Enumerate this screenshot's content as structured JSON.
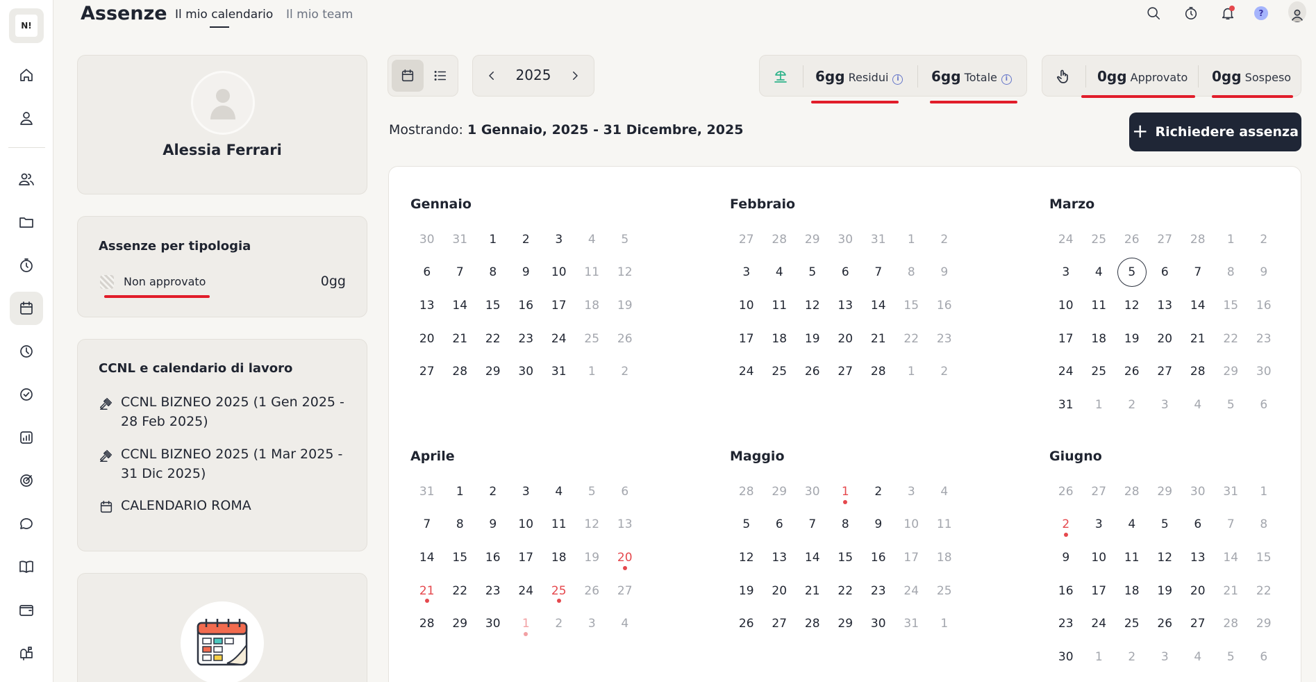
{
  "sidebar": {
    "logo_text": "N!",
    "items": [
      {
        "name": "home-icon"
      },
      {
        "name": "user-icon"
      },
      {
        "name": "users-icon"
      },
      {
        "name": "folder-icon"
      },
      {
        "name": "stopwatch-icon"
      },
      {
        "name": "calendar-icon",
        "active": true
      },
      {
        "name": "clock-pie-icon"
      },
      {
        "name": "check-circle-icon"
      },
      {
        "name": "chart-icon"
      },
      {
        "name": "target-icon"
      },
      {
        "name": "chat-icon"
      },
      {
        "name": "book-icon"
      },
      {
        "name": "wallet-icon"
      },
      {
        "name": "mailbox-icon"
      }
    ]
  },
  "header": {
    "title": "Assenze",
    "tabs": [
      {
        "label": "Il mio calendario",
        "active": true
      },
      {
        "label": "Il mio team",
        "active": false
      }
    ],
    "help_label": "?"
  },
  "profile": {
    "name": "Alessia Ferrari"
  },
  "absence_types": {
    "title": "Assenze per tipologia",
    "items": [
      {
        "label": "Non approvato",
        "value": "0gg"
      }
    ]
  },
  "ccnl": {
    "title": "CCNL e calendario di lavoro",
    "items": [
      {
        "icon": "gavel-icon",
        "label": "CCNL BIZNEO 2025 (1 Gen 2025 - 28 Feb 2025)"
      },
      {
        "icon": "gavel-icon",
        "label": "CCNL BIZNEO 2025 (1 Mar 2025 - 31 Dic 2025)"
      },
      {
        "icon": "calendar-icon",
        "label": "CALENDARIO ROMA"
      }
    ]
  },
  "year_nav": {
    "year": "2025"
  },
  "stats": {
    "residui": {
      "value": "6gg",
      "label": "Residui"
    },
    "totale": {
      "value": "6gg",
      "label": "Totale"
    },
    "approvato": {
      "value": "0gg",
      "label": "Approvato"
    },
    "sospeso": {
      "value": "0gg",
      "label": "Sospeso"
    }
  },
  "showing": {
    "prefix": "Mostrando: ",
    "range": "1 Gennaio, 2025 - 31 Dicembre, 2025"
  },
  "request_button": {
    "label": "Richiedere assenza"
  },
  "colors": {
    "primary_button": "#1f2636",
    "holiday": "#e5484d",
    "panel_bg": "#efede9"
  },
  "calendar": {
    "months": [
      {
        "name": "Gennaio",
        "days": [
          {
            "d": "30",
            "out": true
          },
          {
            "d": "31",
            "out": true
          },
          {
            "d": "1"
          },
          {
            "d": "2"
          },
          {
            "d": "3"
          },
          {
            "d": "4",
            "out": true
          },
          {
            "d": "5",
            "out": true
          },
          {
            "d": "6"
          },
          {
            "d": "7"
          },
          {
            "d": "8"
          },
          {
            "d": "9"
          },
          {
            "d": "10"
          },
          {
            "d": "11",
            "out": true
          },
          {
            "d": "12",
            "out": true
          },
          {
            "d": "13"
          },
          {
            "d": "14"
          },
          {
            "d": "15"
          },
          {
            "d": "16"
          },
          {
            "d": "17"
          },
          {
            "d": "18",
            "out": true
          },
          {
            "d": "19",
            "out": true
          },
          {
            "d": "20"
          },
          {
            "d": "21"
          },
          {
            "d": "22"
          },
          {
            "d": "23"
          },
          {
            "d": "24"
          },
          {
            "d": "25",
            "out": true
          },
          {
            "d": "26",
            "out": true
          },
          {
            "d": "27"
          },
          {
            "d": "28"
          },
          {
            "d": "29"
          },
          {
            "d": "30"
          },
          {
            "d": "31"
          },
          {
            "d": "1",
            "out": true
          },
          {
            "d": "2",
            "out": true
          }
        ]
      },
      {
        "name": "Febbraio",
        "days": [
          {
            "d": "27",
            "out": true
          },
          {
            "d": "28",
            "out": true
          },
          {
            "d": "29",
            "out": true
          },
          {
            "d": "30",
            "out": true
          },
          {
            "d": "31",
            "out": true
          },
          {
            "d": "1",
            "out": true
          },
          {
            "d": "2",
            "out": true
          },
          {
            "d": "3"
          },
          {
            "d": "4"
          },
          {
            "d": "5"
          },
          {
            "d": "6"
          },
          {
            "d": "7"
          },
          {
            "d": "8",
            "out": true
          },
          {
            "d": "9",
            "out": true
          },
          {
            "d": "10"
          },
          {
            "d": "11"
          },
          {
            "d": "12"
          },
          {
            "d": "13"
          },
          {
            "d": "14"
          },
          {
            "d": "15",
            "out": true
          },
          {
            "d": "16",
            "out": true
          },
          {
            "d": "17"
          },
          {
            "d": "18"
          },
          {
            "d": "19"
          },
          {
            "d": "20"
          },
          {
            "d": "21"
          },
          {
            "d": "22",
            "out": true
          },
          {
            "d": "23",
            "out": true
          },
          {
            "d": "24"
          },
          {
            "d": "25"
          },
          {
            "d": "26"
          },
          {
            "d": "27"
          },
          {
            "d": "28"
          },
          {
            "d": "1",
            "out": true
          },
          {
            "d": "2",
            "out": true
          }
        ]
      },
      {
        "name": "Marzo",
        "days": [
          {
            "d": "24",
            "out": true
          },
          {
            "d": "25",
            "out": true
          },
          {
            "d": "26",
            "out": true
          },
          {
            "d": "27",
            "out": true
          },
          {
            "d": "28",
            "out": true
          },
          {
            "d": "1",
            "out": true
          },
          {
            "d": "2",
            "out": true
          },
          {
            "d": "3"
          },
          {
            "d": "4"
          },
          {
            "d": "5",
            "today": true
          },
          {
            "d": "6"
          },
          {
            "d": "7"
          },
          {
            "d": "8",
            "out": true
          },
          {
            "d": "9",
            "out": true
          },
          {
            "d": "10"
          },
          {
            "d": "11"
          },
          {
            "d": "12"
          },
          {
            "d": "13"
          },
          {
            "d": "14"
          },
          {
            "d": "15",
            "out": true
          },
          {
            "d": "16",
            "out": true
          },
          {
            "d": "17"
          },
          {
            "d": "18"
          },
          {
            "d": "19"
          },
          {
            "d": "20"
          },
          {
            "d": "21"
          },
          {
            "d": "22",
            "out": true
          },
          {
            "d": "23",
            "out": true
          },
          {
            "d": "24"
          },
          {
            "d": "25"
          },
          {
            "d": "26"
          },
          {
            "d": "27"
          },
          {
            "d": "28"
          },
          {
            "d": "29",
            "out": true
          },
          {
            "d": "30",
            "out": true
          },
          {
            "d": "31"
          },
          {
            "d": "1",
            "out": true
          },
          {
            "d": "2",
            "out": true
          },
          {
            "d": "3",
            "out": true
          },
          {
            "d": "4",
            "out": true
          },
          {
            "d": "5",
            "out": true
          },
          {
            "d": "6",
            "out": true
          }
        ]
      },
      {
        "name": "Aprile",
        "days": [
          {
            "d": "31",
            "out": true
          },
          {
            "d": "1"
          },
          {
            "d": "2"
          },
          {
            "d": "3"
          },
          {
            "d": "4"
          },
          {
            "d": "5",
            "out": true
          },
          {
            "d": "6",
            "out": true
          },
          {
            "d": "7"
          },
          {
            "d": "8"
          },
          {
            "d": "9"
          },
          {
            "d": "10"
          },
          {
            "d": "11"
          },
          {
            "d": "12",
            "out": true
          },
          {
            "d": "13",
            "out": true
          },
          {
            "d": "14"
          },
          {
            "d": "15"
          },
          {
            "d": "16"
          },
          {
            "d": "17"
          },
          {
            "d": "18"
          },
          {
            "d": "19",
            "out": true
          },
          {
            "d": "20",
            "holiday": true
          },
          {
            "d": "21",
            "holiday": true
          },
          {
            "d": "22"
          },
          {
            "d": "23"
          },
          {
            "d": "24"
          },
          {
            "d": "25",
            "holiday": true
          },
          {
            "d": "26",
            "out": true
          },
          {
            "d": "27",
            "out": true
          },
          {
            "d": "28"
          },
          {
            "d": "29"
          },
          {
            "d": "30"
          },
          {
            "d": "1",
            "out": true,
            "holiday": true
          },
          {
            "d": "2",
            "out": true
          },
          {
            "d": "3",
            "out": true
          },
          {
            "d": "4",
            "out": true
          }
        ]
      },
      {
        "name": "Maggio",
        "days": [
          {
            "d": "28",
            "out": true
          },
          {
            "d": "29",
            "out": true
          },
          {
            "d": "30",
            "out": true
          },
          {
            "d": "1",
            "holiday": true
          },
          {
            "d": "2"
          },
          {
            "d": "3",
            "out": true
          },
          {
            "d": "4",
            "out": true
          },
          {
            "d": "5"
          },
          {
            "d": "6"
          },
          {
            "d": "7"
          },
          {
            "d": "8"
          },
          {
            "d": "9"
          },
          {
            "d": "10",
            "out": true
          },
          {
            "d": "11",
            "out": true
          },
          {
            "d": "12"
          },
          {
            "d": "13"
          },
          {
            "d": "14"
          },
          {
            "d": "15"
          },
          {
            "d": "16"
          },
          {
            "d": "17",
            "out": true
          },
          {
            "d": "18",
            "out": true
          },
          {
            "d": "19"
          },
          {
            "d": "20"
          },
          {
            "d": "21"
          },
          {
            "d": "22"
          },
          {
            "d": "23"
          },
          {
            "d": "24",
            "out": true
          },
          {
            "d": "25",
            "out": true
          },
          {
            "d": "26"
          },
          {
            "d": "27"
          },
          {
            "d": "28"
          },
          {
            "d": "29"
          },
          {
            "d": "30"
          },
          {
            "d": "31",
            "out": true
          },
          {
            "d": "1",
            "out": true
          }
        ]
      },
      {
        "name": "Giugno",
        "days": [
          {
            "d": "26",
            "out": true
          },
          {
            "d": "27",
            "out": true
          },
          {
            "d": "28",
            "out": true
          },
          {
            "d": "29",
            "out": true
          },
          {
            "d": "30",
            "out": true
          },
          {
            "d": "31",
            "out": true
          },
          {
            "d": "1",
            "out": true
          },
          {
            "d": "2",
            "holiday": true
          },
          {
            "d": "3"
          },
          {
            "d": "4"
          },
          {
            "d": "5"
          },
          {
            "d": "6"
          },
          {
            "d": "7",
            "out": true
          },
          {
            "d": "8",
            "out": true
          },
          {
            "d": "9"
          },
          {
            "d": "10"
          },
          {
            "d": "11"
          },
          {
            "d": "12"
          },
          {
            "d": "13"
          },
          {
            "d": "14",
            "out": true
          },
          {
            "d": "15",
            "out": true
          },
          {
            "d": "16"
          },
          {
            "d": "17"
          },
          {
            "d": "18"
          },
          {
            "d": "19"
          },
          {
            "d": "20"
          },
          {
            "d": "21",
            "out": true
          },
          {
            "d": "22",
            "out": true
          },
          {
            "d": "23"
          },
          {
            "d": "24"
          },
          {
            "d": "25"
          },
          {
            "d": "26"
          },
          {
            "d": "27"
          },
          {
            "d": "28",
            "out": true
          },
          {
            "d": "29",
            "out": true
          },
          {
            "d": "30"
          },
          {
            "d": "1",
            "out": true
          },
          {
            "d": "2",
            "out": true
          },
          {
            "d": "3",
            "out": true
          },
          {
            "d": "4",
            "out": true
          },
          {
            "d": "5",
            "out": true
          },
          {
            "d": "6",
            "out": true
          }
        ]
      }
    ]
  }
}
